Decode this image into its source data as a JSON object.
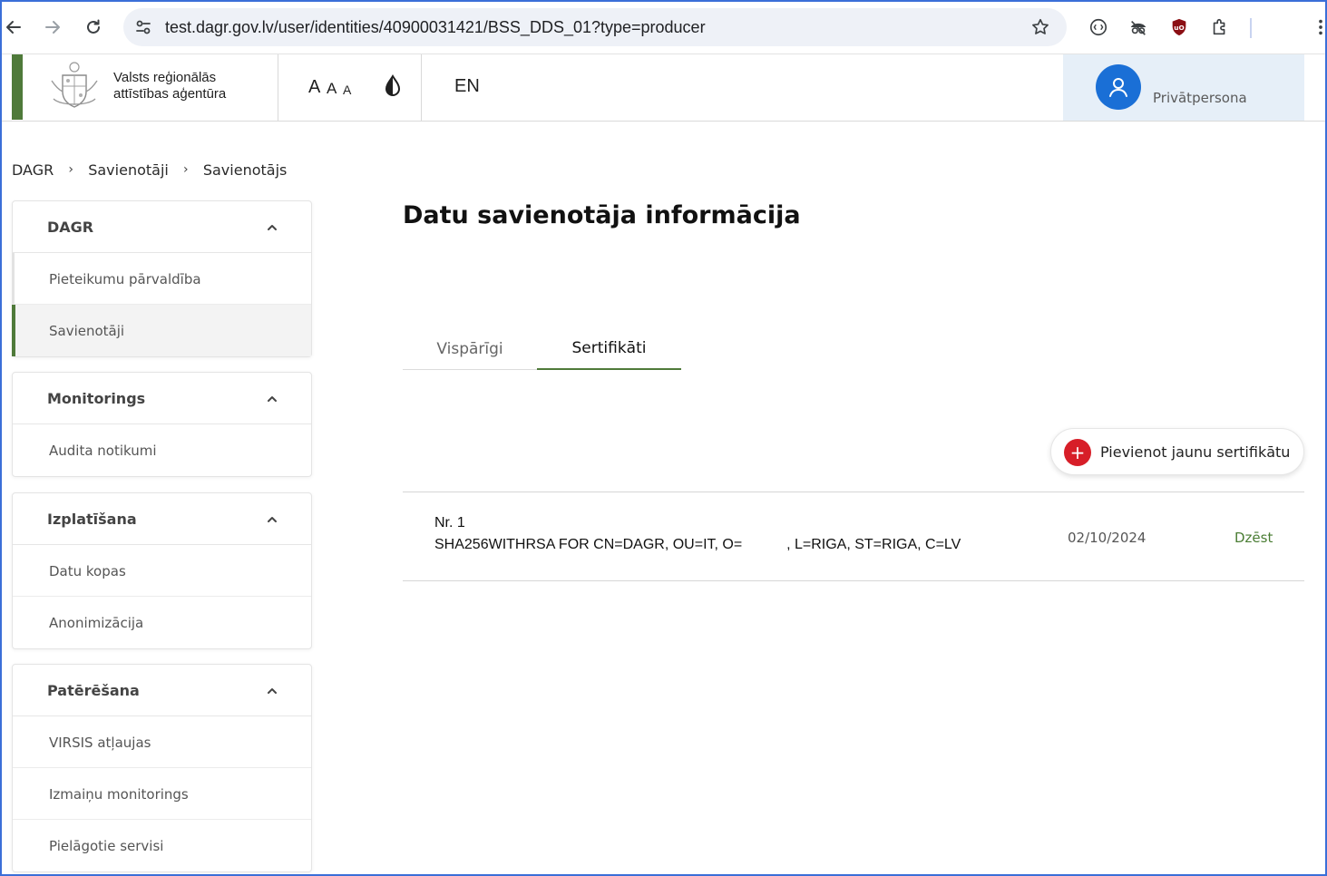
{
  "browser": {
    "url": "test.dagr.gov.lv/user/identities/40900031421/BSS_DDS_01?type=producer",
    "icons": {
      "back": "back-arrow-icon",
      "forward": "forward-arrow-icon",
      "reload": "reload-icon",
      "site_info": "site-settings-icon",
      "bookmark": "star-icon",
      "extensions": [
        "media-extension-icon",
        "incognito-extension-icon",
        "ublock-shield-icon",
        "puzzle-extensions-icon"
      ],
      "menu": "kebab-menu-icon"
    }
  },
  "header": {
    "org_name": "Valsts reģionālās attīstības aģentūra",
    "font_sizes": [
      "A",
      "A",
      "A"
    ],
    "language": "EN",
    "user_label": "Privātpersona",
    "accent_color": "#4f7a3a"
  },
  "breadcrumb": [
    "DAGR",
    "Savienotāji",
    "Savienotājs"
  ],
  "sidebar": [
    {
      "title": "DAGR",
      "items": [
        "Pieteikumu pārvaldība",
        "Savienotāji"
      ]
    },
    {
      "title": "Monitorings",
      "items": [
        "Audita notikumi"
      ]
    },
    {
      "title": "Izplatīšana",
      "items": [
        "Datu kopas",
        "Anonimizācija"
      ]
    },
    {
      "title": "Patērēšana",
      "items": [
        "VIRSIS atļaujas",
        "Izmaiņu monitorings",
        "Pielāgotie servisi"
      ]
    }
  ],
  "main": {
    "title": "Datu savienotāja informācija",
    "tabs": [
      "Vispārīgi",
      "Sertifikāti"
    ],
    "active_tab": "Sertifikāti",
    "add_button": "Pievienot jaunu sertifikātu",
    "certificates": [
      {
        "nr": "Nr. 1",
        "subject": "SHA256WITHRSA FOR CN=DAGR, OU=IT, O=           , L=RIGA, ST=RIGA, C=LV",
        "date": "02/10/2024",
        "action": "Dzēst"
      }
    ]
  }
}
